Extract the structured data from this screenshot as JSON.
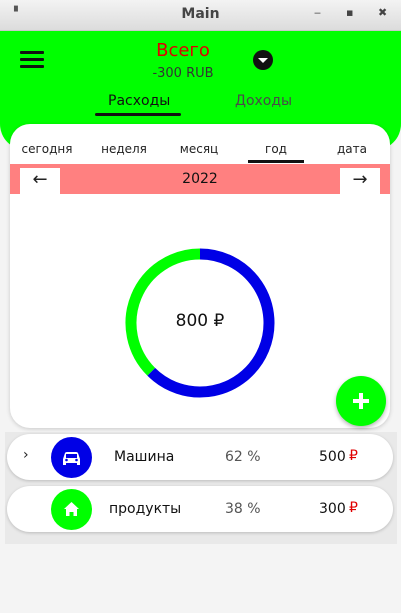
{
  "window": {
    "title": "Main",
    "pin": "▘",
    "minimize": "‒",
    "maximize": "▪",
    "close": "✖"
  },
  "header": {
    "total_label": "Всего",
    "total_value": "-300 RUB",
    "tabs": [
      {
        "label": "Расходы",
        "active": true
      },
      {
        "label": "Доходы",
        "active": false
      }
    ]
  },
  "period": {
    "tabs": [
      {
        "label": "сегодня",
        "active": false
      },
      {
        "label": "неделя",
        "active": false
      },
      {
        "label": "месяц",
        "active": false
      },
      {
        "label": "год",
        "active": true
      },
      {
        "label": "дата",
        "active": false
      }
    ],
    "current": "2022",
    "prev_icon": "←",
    "next_icon": "→"
  },
  "chart": {
    "center_label": "800 ₽",
    "colors": {
      "blue": "#0000e6",
      "green": "#00ff00"
    }
  },
  "chart_data": {
    "type": "pie",
    "categories": [
      "Машина",
      "продукты"
    ],
    "values": [
      500,
      300
    ]
  },
  "categories": [
    {
      "name": "Машина",
      "percent": "62 %",
      "amount": "500",
      "currency": "₽",
      "color": "#0000e6",
      "icon": "car-icon"
    },
    {
      "name": "продукты",
      "percent": "38 %",
      "amount": "300",
      "currency": "₽",
      "color": "#00ff00",
      "icon": "home-icon"
    }
  ],
  "expand_icon": "›",
  "colors": {
    "accent": "#00ff00",
    "expense_red": "#e00000",
    "year_bar": "#ff8080"
  }
}
